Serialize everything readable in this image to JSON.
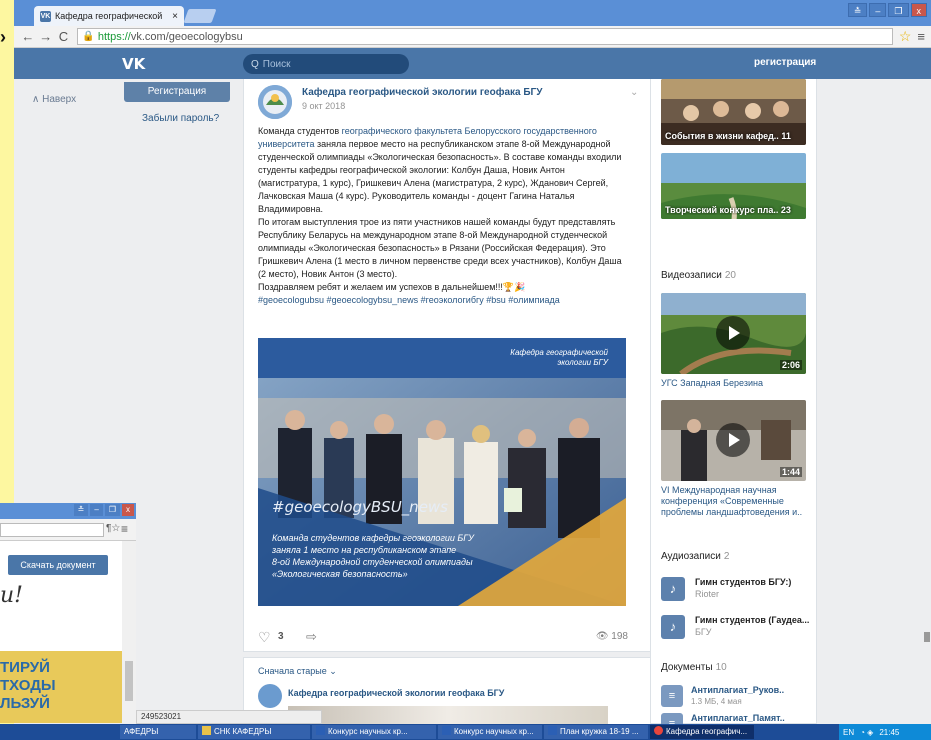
{
  "browser": {
    "tab_title": "Кафедра географической",
    "tab_close": "×",
    "fav_glyph": "VK",
    "left_glyph": "›",
    "back": "←",
    "forward": "→",
    "reload": "C",
    "url_https": "https://",
    "url_rest": "vk.com/geoecologybsu",
    "star": "☆",
    "menu": "≡",
    "window_buttons": [
      "≛",
      "–",
      "❐",
      "x"
    ]
  },
  "vk_header": {
    "logo": "VK",
    "search_icon": "Q",
    "search_placeholder": "Поиск",
    "register_link": "регистрация"
  },
  "left_menu": {
    "back_to_top": "∧ Наверх",
    "register_button": "Регистрация",
    "forgot_password": "Забыли пароль?"
  },
  "post": {
    "author": "Кафедра географической экологии геофака БГУ",
    "date": "9 окт 2018",
    "chevron": "⌄",
    "text_before_link": "Команда студентов ",
    "link_text": "географического факультета Белорусского государственного университета",
    "text_p1_rest": " заняла первое место на республиканском этапе 8-ой Международной студенческой олимпиады «Экологическая безопасность». В составе команды входили студенты кафедры географической экологии: Колбун Даша, Новик Антон (магистратура, 1 курс), Гришкевич Алена (магистратура, 2 курс), Жданович Сергей, Лачковская Маша (4 курс). Руководитель команды - доцент Гагина Наталья Владимировна.",
    "text_p2": "По итогам выступления трое из пяти участников нашей команды будут представлять Республику Беларусь на международном этапе 8-ой Международной студенческой олимпиады «Экологическая безопасность» в Рязани (Российская Федерация). Это Гришкевич Алена (1 место в личном первенстве среди всех участников), Колбун Даша (2 место), Новик Антон (3 место).",
    "text_p3": "Поздравляем ребят и желаем им успехов в дальнейшем!!!🏆🎉",
    "hashtags": "#geoecologubsu #geoecologybsu_news #геоэкологибгу #bsu #олимпиада",
    "photo": {
      "label_line1": "Кафедра географической",
      "label_line2": "экологии БГУ",
      "hashtag": "#geoecologyBSU_news",
      "caption_lines": [
        "Команда студентов кафедры геоэкологии БГУ",
        "заняла 1 место на республиканском этапе",
        "8-ой Международной студенческой олимпиады",
        "«Экологическая безопасность»"
      ]
    },
    "heart": "♡",
    "likes": "3",
    "share": "⇨",
    "views": "👁 198"
  },
  "post2": {
    "sort": "Сначала старые ⌄",
    "author": "Кафедра географической экологии геофака БГУ"
  },
  "sidebar": {
    "albums": [
      {
        "title": "События в жизни кафед..",
        "count": "11"
      },
      {
        "title": "Творческий конкурс пла..",
        "count": "23"
      }
    ],
    "videos_header": "Видеозаписи",
    "videos_count": "20",
    "videos": [
      {
        "title": "УГС Западная Березина",
        "duration": "2:06"
      },
      {
        "title": "VI Международная научная конференция «Современные проблемы ландшафтоведения и..",
        "duration": "1:44"
      }
    ],
    "audio_header": "Аудиозаписи",
    "audio_count": "2",
    "audio": [
      {
        "title": "Гимн студентов БГУ:)",
        "artist": "Rioter"
      },
      {
        "title": "Гимн студентов (Гаудеа...",
        "artist": "БГУ"
      }
    ],
    "note_glyph": "♪",
    "docs_header": "Документы",
    "docs_count": "10",
    "docs": [
      {
        "title": "Антиплагиат_Руков..",
        "meta": "1.3 МБ, 4 мая"
      },
      {
        "title": "Антиплагиат_Памят..",
        "meta": ""
      }
    ],
    "doc_glyph": "≡"
  },
  "second_window": {
    "download_button": "Скачать документ",
    "script_text": "и!",
    "band_lines": [
      "ТИРУЙ",
      "ТХОДЫ",
      "ЛЬЗУЙ"
    ],
    "bar_icon1": "¶☆",
    "bar_icon2": "≡",
    "ctl": [
      "≛",
      "–",
      "❐",
      "x"
    ]
  },
  "status_url": "249523021",
  "taskbar": {
    "items": [
      "АФЕДРЫ",
      "СНК КАФЕДРЫ",
      "Конкурс научных кр...",
      "Конкурс научных кр...",
      "План кружка 18-19 ...",
      "Кафедра географич..."
    ],
    "lang": "EN",
    "clock": "21:45"
  },
  "colors": {
    "vk_blue": "#4a76a8",
    "link": "#2a5885",
    "desktop": "#fdf7a0"
  }
}
